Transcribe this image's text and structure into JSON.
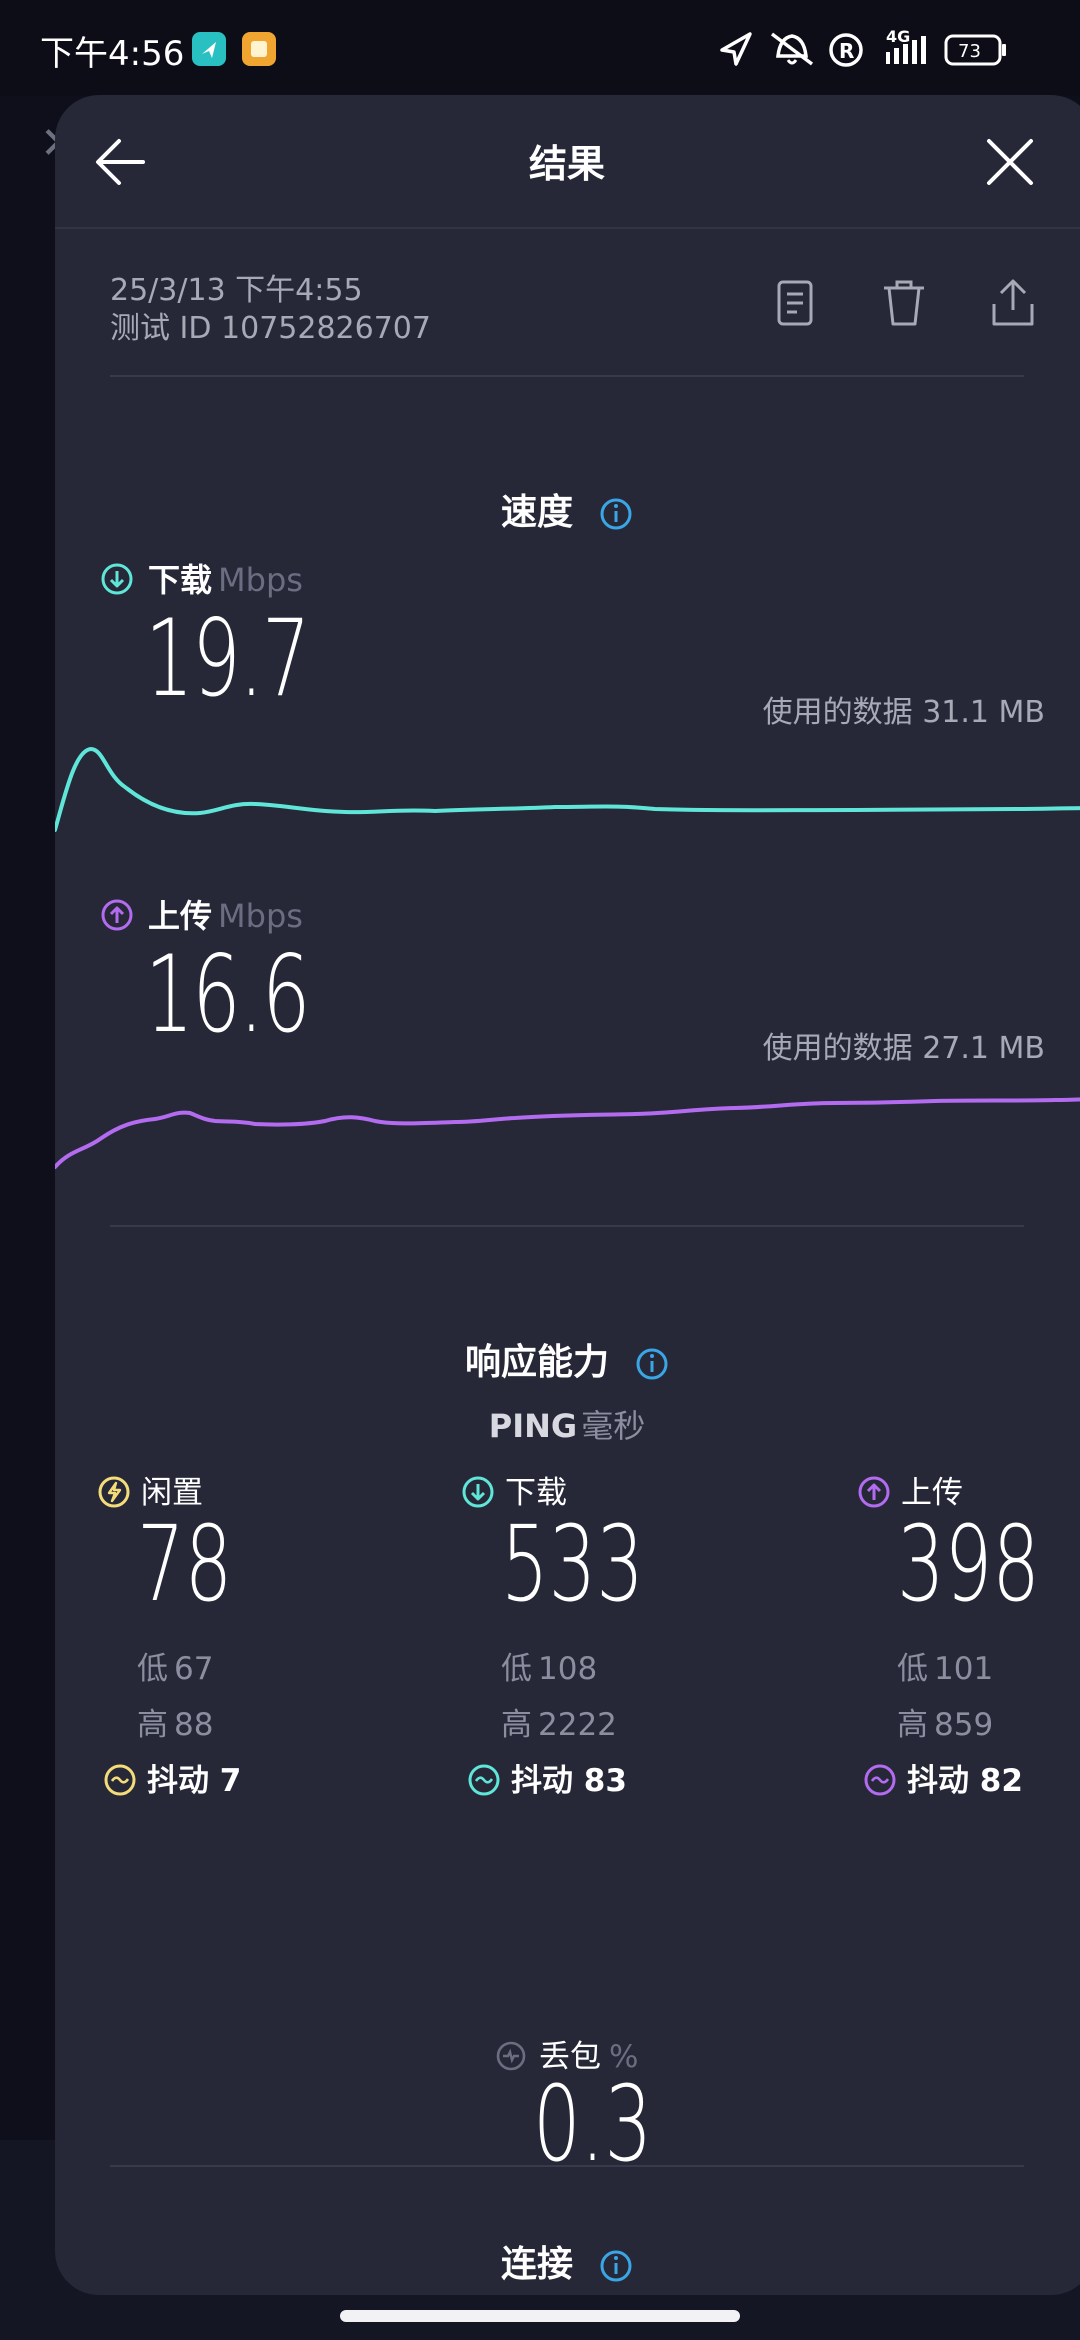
{
  "status_bar": {
    "time": "下午4:56",
    "network": "4G",
    "battery": "73"
  },
  "header": {
    "title": "结果",
    "back_icon": "arrow-left-icon",
    "close_icon": "close-icon"
  },
  "meta": {
    "date": "25/3/13 下午4:55",
    "test_id": "测试 ID 10752826707",
    "actions": [
      "document-icon",
      "trash-icon",
      "share-icon"
    ]
  },
  "speed": {
    "section_title": "速度",
    "download": {
      "label": "下载",
      "unit": "Mbps",
      "value": "19.7",
      "data_used": "使用的数据 31.1 MB",
      "color": "#5fe6d9"
    },
    "upload": {
      "label": "上传",
      "unit": "Mbps",
      "value": "16.6",
      "data_used": "使用的数据 27.1 MB",
      "color": "#b36bf0"
    }
  },
  "responsiveness": {
    "section_title": "响应能力",
    "ping_title": "PING",
    "ping_unit": "毫秒",
    "idle": {
      "label": "闲置",
      "value": "78",
      "low_label": "低",
      "low": "67",
      "high_label": "高",
      "high": "88",
      "jitter_label": "抖动",
      "jitter": "7",
      "color": "#f4dc7a"
    },
    "download": {
      "label": "下载",
      "value": "533",
      "low_label": "低",
      "low": "108",
      "high_label": "高",
      "high": "2222",
      "jitter_label": "抖动",
      "jitter": "83",
      "color": "#5fe6d9"
    },
    "upload": {
      "label": "上传",
      "value": "398",
      "low_label": "低",
      "low": "101",
      "high_label": "高",
      "high": "859",
      "jitter_label": "抖动",
      "jitter": "82",
      "color": "#b36bf0"
    },
    "packet_loss": {
      "label": "丢包",
      "unit": "%",
      "value": "0.3"
    }
  },
  "connection": {
    "section_title": "连接"
  },
  "colors": {
    "background": "#0c0d17",
    "sheet": "#262838",
    "info_blue": "#3aa6e6"
  }
}
